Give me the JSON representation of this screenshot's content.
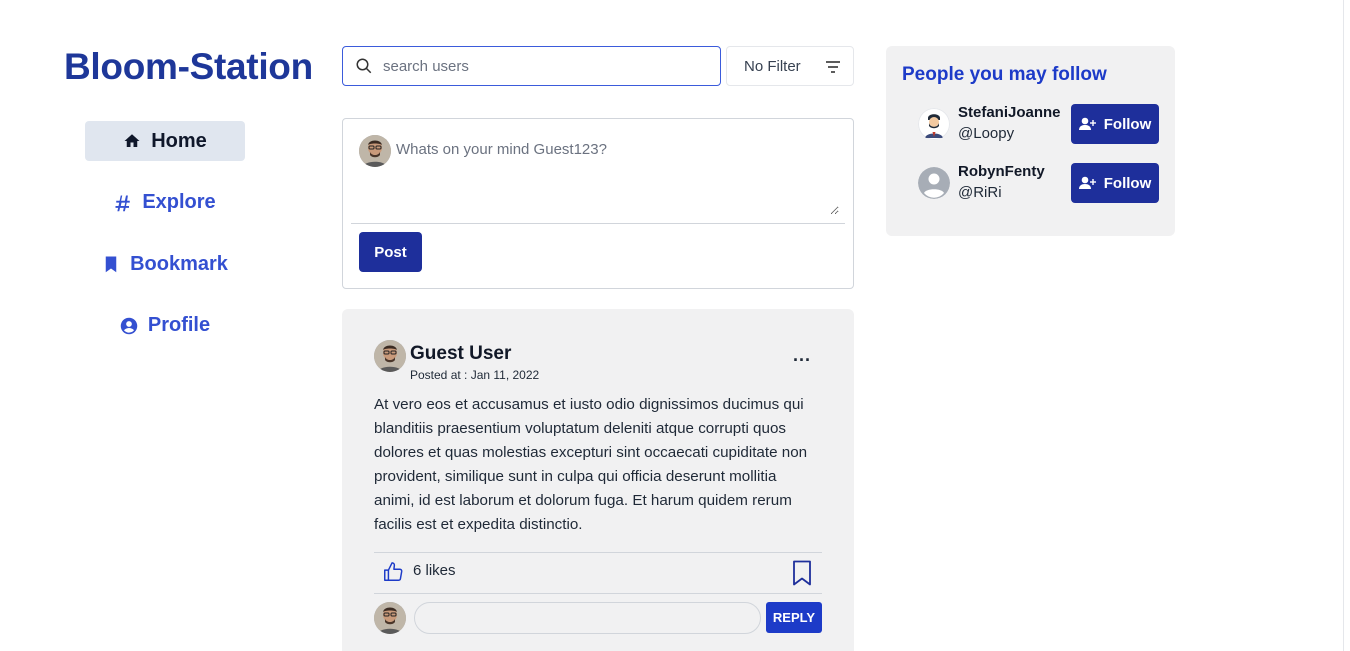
{
  "brand": "Bloom-Station",
  "nav": {
    "items": [
      {
        "label": "Home",
        "icon": "home-icon",
        "active": true
      },
      {
        "label": "Explore",
        "icon": "hashtag-icon",
        "active": false
      },
      {
        "label": "Bookmark",
        "icon": "bookmark-icon",
        "active": false
      },
      {
        "label": "Profile",
        "icon": "user-circle-icon",
        "active": false
      }
    ]
  },
  "search": {
    "placeholder": "search users",
    "value": ""
  },
  "filter": {
    "label": "No Filter"
  },
  "composer": {
    "placeholder": "Whats on your mind Guest123?",
    "post_label": "Post"
  },
  "post": {
    "author": "Guest User",
    "date": "Posted at : Jan 11, 2022",
    "more": "...",
    "body": "At vero eos et accusamus et iusto odio dignissimos ducimus qui blanditiis praesentium voluptatum deleniti atque corrupti quos dolores et quas molestias excepturi sint occaecati cupiditate non provident, similique sunt in culpa qui officia deserunt mollitia animi, id est laborum et dolorum fuga. Et harum quidem rerum facilis est et expedita distinctio.",
    "likes": "6 likes",
    "reply_label": "REPLY",
    "comment_value": ""
  },
  "suggestions": {
    "title": "People you may follow",
    "follow_label": "Follow",
    "users": [
      {
        "name": "StefaniJoanne",
        "handle": "@Loopy"
      },
      {
        "name": "RobynFenty",
        "handle": "@RiRi"
      }
    ]
  },
  "colors": {
    "brand": "#1e3799",
    "accent": "#1d3bc8",
    "button": "#1e2f9b"
  }
}
